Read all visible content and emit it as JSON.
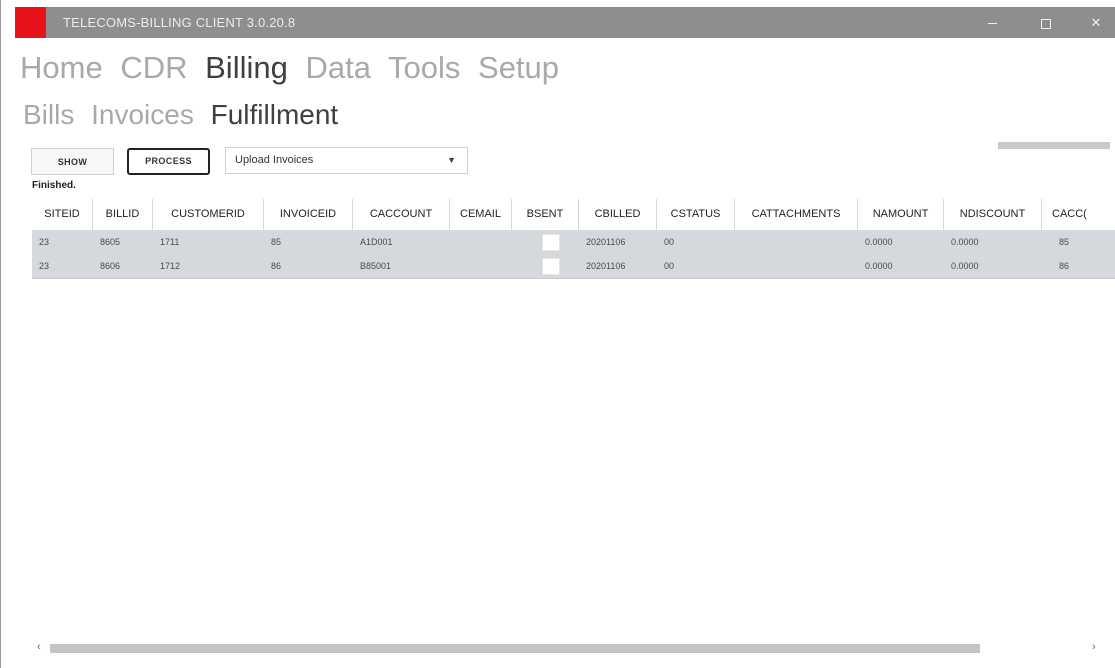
{
  "window": {
    "title": "TELECOMS-BILLING CLIENT 3.0.20.8",
    "app_icon_color": "#e8121b"
  },
  "menu": {
    "items": [
      "Home",
      "CDR",
      "Billing",
      "Data",
      "Tools",
      "Setup"
    ],
    "active": "Billing"
  },
  "submenu": {
    "items": [
      "Bills",
      "Invoices",
      "Fulfillment"
    ],
    "active": "Fulfillment"
  },
  "toolbar": {
    "show_label": "SHOW",
    "process_label": "PROCESS",
    "action_select_value": "Upload Invoices",
    "status_text": "Finished."
  },
  "grid": {
    "columns": [
      "SITEID",
      "BILLID",
      "CUSTOMERID",
      "INVOICEID",
      "CACCOUNT",
      "CEMAIL",
      "BSENT",
      "CBILLED",
      "CSTATUS",
      "CATTACHMENTS",
      "NAMOUNT",
      "NDISCOUNT",
      "CACC("
    ],
    "rows": [
      {
        "siteid": "23",
        "billid": "8605",
        "customerid": "1711",
        "invoiceid": "85",
        "caccount": "A1D001",
        "cemail": "",
        "bsent": false,
        "cbilled": "20201106",
        "cstatus": "00",
        "cattachments": "",
        "namount": "0.0000",
        "ndiscount": "0.0000",
        "cacc": "85"
      },
      {
        "siteid": "23",
        "billid": "8606",
        "customerid": "1712",
        "invoiceid": "86",
        "caccount": "B85001",
        "cemail": "",
        "bsent": false,
        "cbilled": "20201106",
        "cstatus": "00",
        "cattachments": "",
        "namount": "0.0000",
        "ndiscount": "0.0000",
        "cacc": "86"
      }
    ]
  },
  "icons": {
    "scroll_left": "chevron-left-icon",
    "scroll_right": "chevron-right-icon",
    "dropdown": "caret-down-icon"
  },
  "colors": {
    "titlebar": "#8e8e8e",
    "row_background": "#d5d8dd"
  }
}
